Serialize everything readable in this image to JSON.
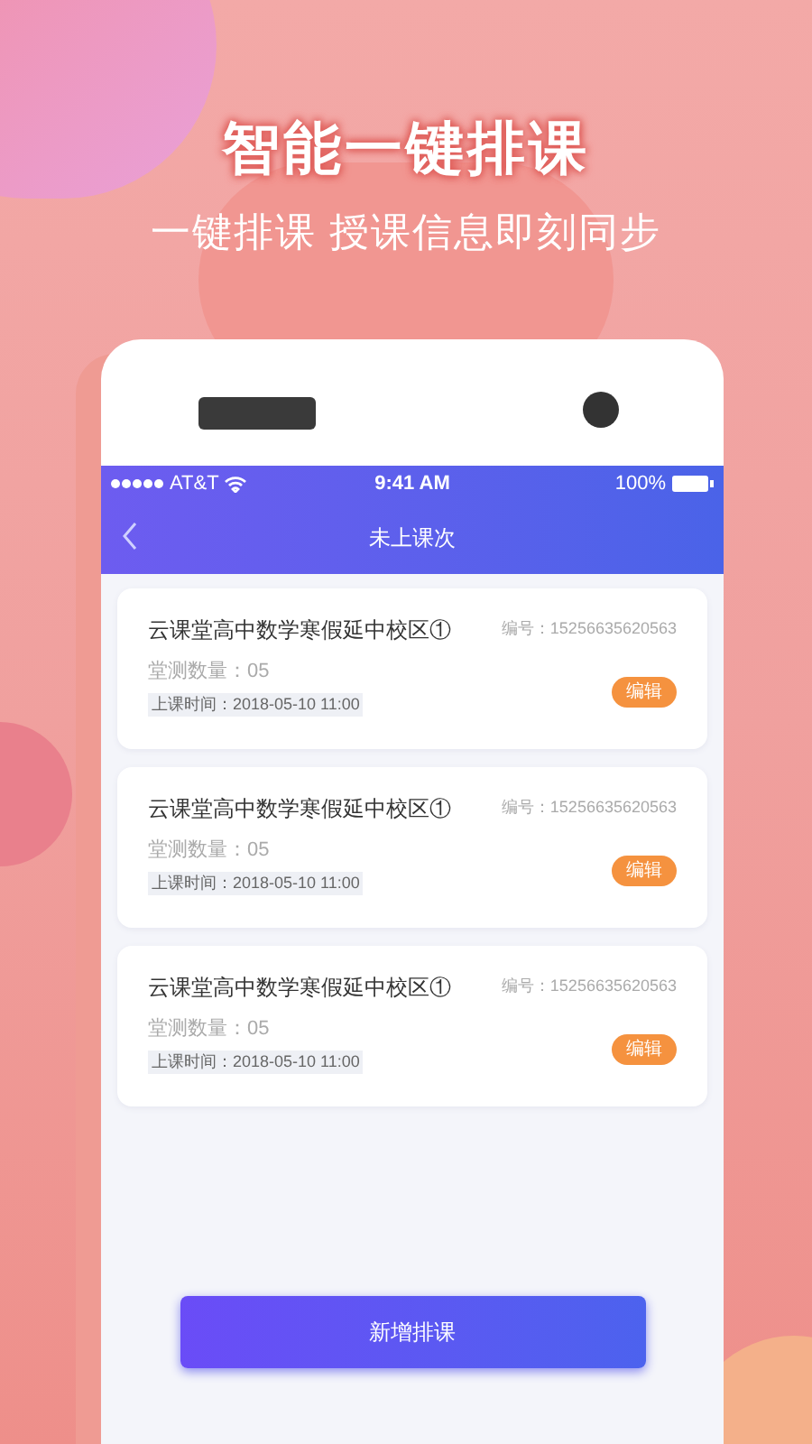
{
  "promo": {
    "headline": "智能一键排课",
    "subtitle": "一键排课 授课信息即刻同步"
  },
  "status_bar": {
    "carrier": "AT&T",
    "time": "9:41 AM",
    "battery": "100%"
  },
  "nav": {
    "title": "未上课次"
  },
  "lessons": [
    {
      "name": "云课堂高中数学寒假延中校区①",
      "code": "编号：15256635620563",
      "count": "堂测数量：05",
      "time": "上课时间：2018-05-10 11:00",
      "action": "编辑"
    },
    {
      "name": "云课堂高中数学寒假延中校区①",
      "code": "编号：15256635620563",
      "count": "堂测数量：05",
      "time": "上课时间：2018-05-10 11:00",
      "action": "编辑"
    },
    {
      "name": "云课堂高中数学寒假延中校区①",
      "code": "编号：15256635620563",
      "count": "堂测数量：05",
      "time": "上课时间：2018-05-10 11:00",
      "action": "编辑"
    }
  ],
  "primary_button": "新增排课"
}
